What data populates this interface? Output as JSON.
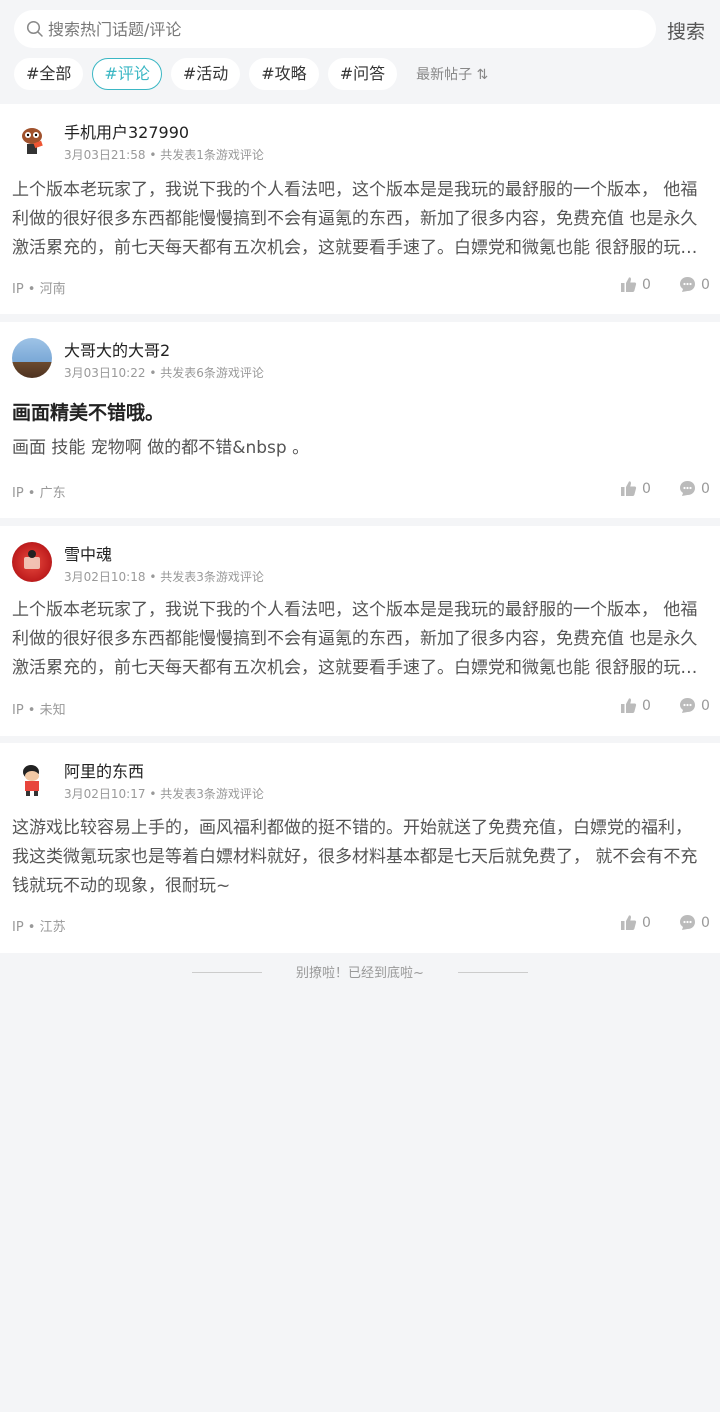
{
  "search": {
    "placeholder": "搜索热门话题/评论",
    "button_label": "搜索"
  },
  "tabs": [
    {
      "label": "#全部",
      "active": false
    },
    {
      "label": "#评论",
      "active": true
    },
    {
      "label": "#活动",
      "active": false
    },
    {
      "label": "#攻略",
      "active": false
    },
    {
      "label": "#问答",
      "active": false
    }
  ],
  "sort_label": "最新帖子 ⇅",
  "posts": [
    {
      "username": "手机用户327990",
      "time": "3月03日21:58",
      "count_text": "共发表1条游戏评论",
      "title": "",
      "body": "上个版本老玩家了，我说下我的个人看法吧，这个版本是是我玩的最舒服的一个版本， 他福利做的很好很多东西都能慢慢搞到不会有逼氪的东西，新加了很多内容，免费充值 也是永久激活累充的，前七天每天都有五次机会，这就要看手速了。白嫖党和微氪也能 很舒服的玩下去的。",
      "ip": "河南",
      "likes": "0",
      "comments": "0"
    },
    {
      "username": "大哥大的大哥2",
      "time": "3月03日10:22",
      "count_text": "共发表6条游戏评论",
      "title": "画面精美不错哦。",
      "body": "画面 技能 宠物啊 做的都不错&nbsp 。",
      "ip": "广东",
      "likes": "0",
      "comments": "0"
    },
    {
      "username": "雪中魂",
      "time": "3月02日10:18",
      "count_text": "共发表3条游戏评论",
      "title": "",
      "body": "上个版本老玩家了，我说下我的个人看法吧，这个版本是是我玩的最舒服的一个版本， 他福利做的很好很多东西都能慢慢搞到不会有逼氪的东西，新加了很多内容，免费充值 也是永久激活累充的，前七天每天都有五次机会，这就要看手速了。白嫖党和微氪也能 很舒服的玩下去的。",
      "ip": "未知",
      "likes": "0",
      "comments": "0"
    },
    {
      "username": "阿里的东西",
      "time": "3月02日10:17",
      "count_text": "共发表3条游戏评论",
      "title": "",
      "body": "这游戏比较容易上手的，画风福利都做的挺不错的。开始就送了免费充值，白嫖党的福利， 我这类微氪玩家也是等着白嫖材料就好，很多材料基本都是七天后就免费了， 就不会有不充钱就玩不动的现象，很耐玩~",
      "ip": "江苏",
      "likes": "0",
      "comments": "0"
    }
  ],
  "ip_prefix": "IP • ",
  "footer_text": "别撩啦！已经到底啦~"
}
